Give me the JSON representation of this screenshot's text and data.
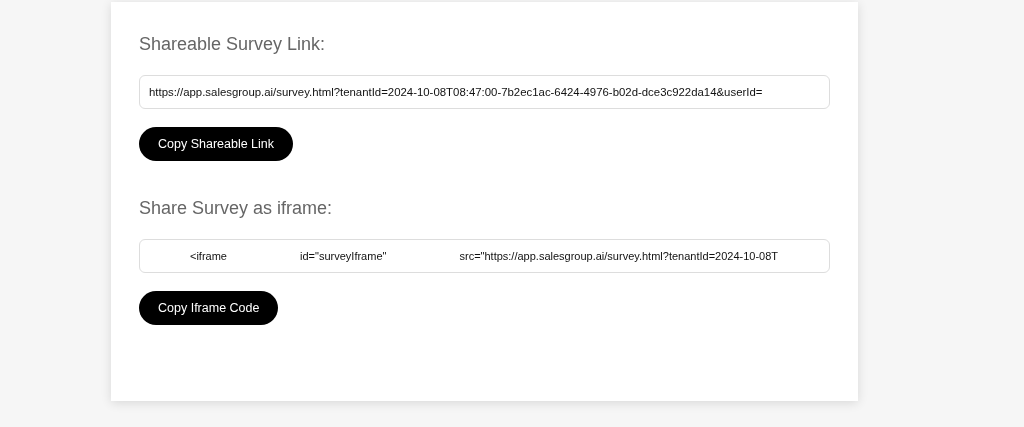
{
  "sections": [
    {
      "heading": "Shareable Survey Link:",
      "field_value": "https://app.salesgroup.ai/survey.html?tenantId=2024-10-08T08:47:00-7b2ec1ac-6424-4976-b02d-dce3c922da14&userId=",
      "kind": "link",
      "button": "Copy Shareable Link"
    },
    {
      "heading": "Share Survey as iframe:",
      "field_value": "<iframe id=\"surveyIframe\" src=\"https://app.salesgroup.ai/survey.html?tenantId=2024-10-08T",
      "kind": "code",
      "button": "Copy Iframe Code"
    }
  ]
}
